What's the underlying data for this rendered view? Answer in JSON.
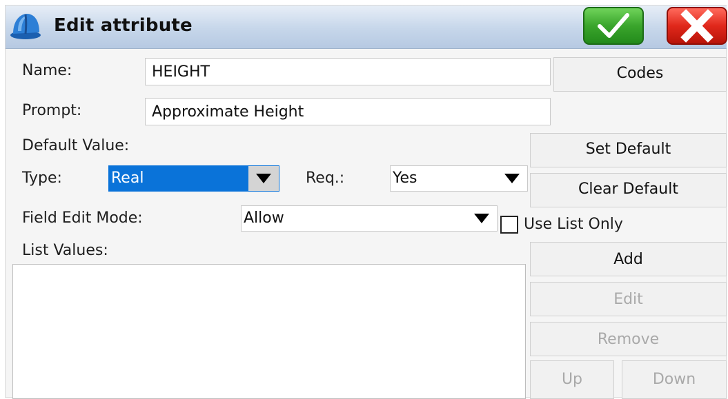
{
  "window": {
    "title": "Edit attribute",
    "icon": "hard-hat-icon",
    "ok_icon": "checkmark-icon",
    "cancel_icon": "close-x-icon"
  },
  "form": {
    "name_label": "Name:",
    "name_value": "HEIGHT",
    "prompt_label": "Prompt:",
    "prompt_value": "Approximate Height",
    "default_value_label": "Default Value:",
    "type_label": "Type:",
    "type_value": "Real",
    "req_label": "Req.:",
    "req_value": "Yes",
    "field_edit_mode_label": "Field Edit Mode:",
    "field_edit_mode_value": "Allow",
    "use_list_only_label": "Use List Only",
    "use_list_only_checked": false,
    "list_values_label": "List Values:",
    "list_values": []
  },
  "buttons": {
    "codes": "Codes",
    "set_default": "Set Default",
    "clear_default": "Clear Default",
    "add": "Add",
    "edit": "Edit",
    "remove": "Remove",
    "up": "Up",
    "down": "Down"
  },
  "colors": {
    "titlebar": "#c6d6ea",
    "ok_green": "#3aa52c",
    "cancel_red": "#e0281b",
    "selection_blue": "#0a73d9"
  }
}
